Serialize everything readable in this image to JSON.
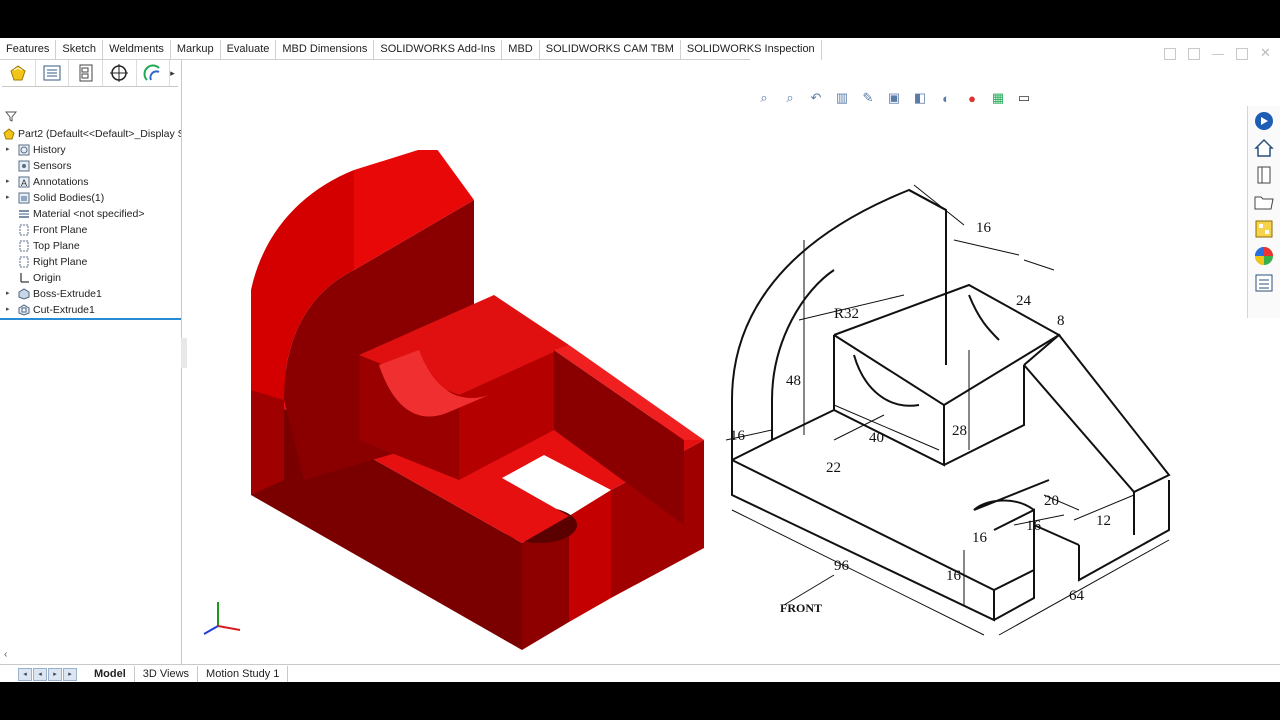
{
  "ribbon": {
    "tabs": [
      "Features",
      "Sketch",
      "Weldments",
      "Markup",
      "Evaluate",
      "MBD Dimensions",
      "SOLIDWORKS Add-Ins",
      "MBD",
      "SOLIDWORKS CAM TBM",
      "SOLIDWORKS Inspection"
    ]
  },
  "tree": {
    "root": "Part2  (Default<<Default>_Display S",
    "items": [
      {
        "label": "History",
        "expandable": true
      },
      {
        "label": "Sensors",
        "expandable": false
      },
      {
        "label": "Annotations",
        "expandable": true
      },
      {
        "label": "Solid Bodies(1)",
        "expandable": true
      },
      {
        "label": "Material <not specified>",
        "expandable": false
      },
      {
        "label": "Front Plane",
        "expandable": false
      },
      {
        "label": "Top Plane",
        "expandable": false
      },
      {
        "label": "Right Plane",
        "expandable": false
      },
      {
        "label": "Origin",
        "expandable": false
      },
      {
        "label": "Boss-Extrude1",
        "expandable": true
      },
      {
        "label": "Cut-Extrude1",
        "expandable": true
      }
    ]
  },
  "bottom_tabs": [
    "Model",
    "3D Views",
    "Motion Study 1"
  ],
  "drawing": {
    "dims": {
      "d16_top": "16",
      "d24": "24",
      "d8": "8",
      "r32": "R32",
      "d48": "48",
      "d16_left": "16",
      "d40": "40",
      "d22": "22",
      "d28": "28",
      "d20": "20",
      "d16_slot": "16",
      "d16_slot2": "16",
      "d12": "12",
      "d16_vert": "16",
      "d96": "96",
      "d64": "64"
    },
    "front_label": "FRONT"
  },
  "colors": {
    "model_red": "#e00000",
    "model_dark": "#8a0000",
    "selection_blue": "#2a8bd5"
  }
}
